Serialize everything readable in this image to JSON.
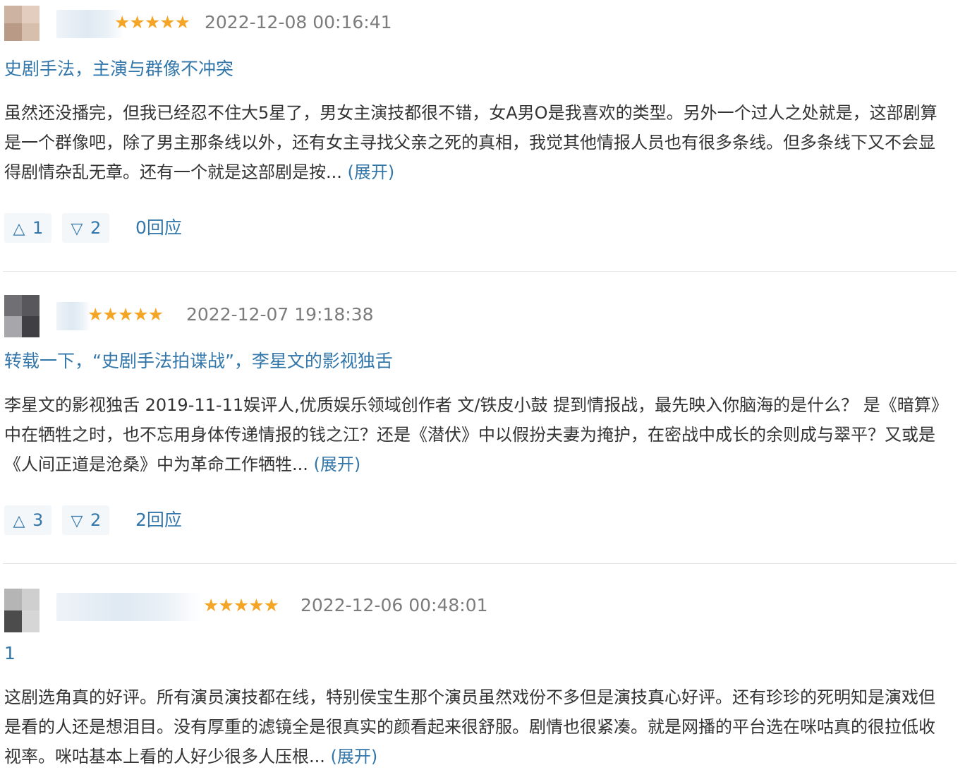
{
  "reviews": [
    {
      "username": "",
      "stars": "★★★★★",
      "time": "2022-12-08 00:16:41",
      "title": "史剧手法，主演与群像不冲突",
      "body": "虽然还没播完，但我已经忍不住大5星了，男女主演技都很不错，女A男O是我喜欢的类型。另外一个过人之处就是，这部剧算是一个群像吧，除了男主那条线以外，还有女主寻找父亲之死的真相，我觉其他情报人员也有很多条线。但多条线下又不会显得剧情杂乱无章。还有一个就是这部剧是按...",
      "expand": "(展开)",
      "up_icon": "△",
      "up_count": "1",
      "down_icon": "▽",
      "down_count": "2",
      "reply": "0回应"
    },
    {
      "username": "",
      "stars": "★★★★★",
      "time": "2022-12-07 19:18:38",
      "title": "转载一下，“史剧手法拍谍战”，李星文的影视独舌",
      "body": "李星文的影视独舌 2019-11-11娱评人,优质娱乐领域创作者 文/铁皮小鼓 提到情报战，最先映入你脑海的是什么？ 是《暗算》中在牺牲之时，也不忘用身体传递情报的钱之江？还是《潜伏》中以假扮夫妻为掩护，在密战中成长的余则成与翠平？又或是《人间正道是沧桑》中为革命工作牺牲...",
      "expand": "(展开)",
      "up_icon": "△",
      "up_count": "3",
      "down_icon": "▽",
      "down_count": "2",
      "reply": "2回应"
    },
    {
      "username": "",
      "stars": "★★★★★",
      "time": "2022-12-06 00:48:01",
      "title": "1",
      "body": "这剧选角真的好评。所有演员演技都在线，特别侯宝生那个演员虽然戏份不多但是演技真心好评。还有珍珍的死明知是演戏但是看的人还是想泪目。没有厚重的滤镜全是很真实的颜看起来很舒服。剧情也很紧凑。就是网播的平台选在咪咕真的很拉低收视率。咪咕基本上看的人好少很多人压根...",
      "expand": "(展开)"
    }
  ],
  "colors": {
    "link": "#3377aa",
    "star": "#f4a525",
    "time": "#7c7c7c",
    "text": "#333333",
    "vote_bg": "#f3f7fa"
  }
}
